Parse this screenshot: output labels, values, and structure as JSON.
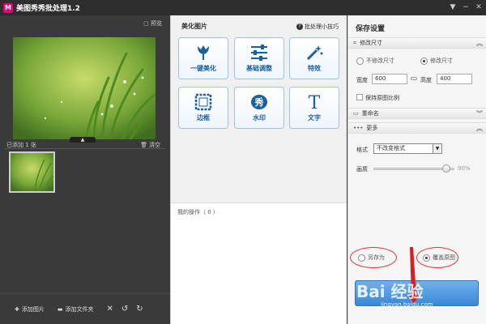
{
  "window": {
    "title": "美图秀秀批处理1.2",
    "icon_letter": "M",
    "controls": [
      "menu-icon",
      "minimize-icon",
      "close-icon"
    ]
  },
  "left": {
    "preview_label": "预览",
    "added_count": "已添加 1 张",
    "clear_label": "清空",
    "add_image": "添加图片",
    "add_folder": "添加文件夹"
  },
  "center": {
    "title": "美化图片",
    "tips": "批处理小技巧",
    "tools": [
      {
        "label": "一键美化",
        "icon": "tulip-icon"
      },
      {
        "label": "基础调整",
        "icon": "sliders-icon"
      },
      {
        "label": "特效",
        "icon": "magic-wand-icon"
      },
      {
        "label": "边框",
        "icon": "frame-icon"
      },
      {
        "label": "水印",
        "icon": "watermark-icon"
      },
      {
        "label": "文字",
        "icon": "text-icon"
      }
    ],
    "tool_glyph_text": "T",
    "tool_glyph_watermark": "秀",
    "ops_title": "我的操作（ 0 ）"
  },
  "right": {
    "title": "保存设置",
    "resize_section": "修改尺寸",
    "no_resize": "不修改尺寸",
    "resize": "修改尺寸",
    "width_label": "宽度",
    "width_value": "600",
    "height_label": "高度",
    "height_value": "400",
    "keep_ratio": "保持原图比例",
    "rename_section": "重命名",
    "more_section": "更多",
    "format_label": "格式",
    "format_value": "不改变格式",
    "quality_label": "画质",
    "quality_value": "90%",
    "quality_level": 0.9,
    "save_as": "另存为",
    "overwrite": "覆盖原图"
  },
  "watermark": {
    "text": "Bai 经验",
    "url": "jingyan.baidu.com"
  },
  "colors": {
    "accent": "#3b87d6",
    "highlight": "#e03030",
    "tool_text": "#1a5fa3"
  }
}
